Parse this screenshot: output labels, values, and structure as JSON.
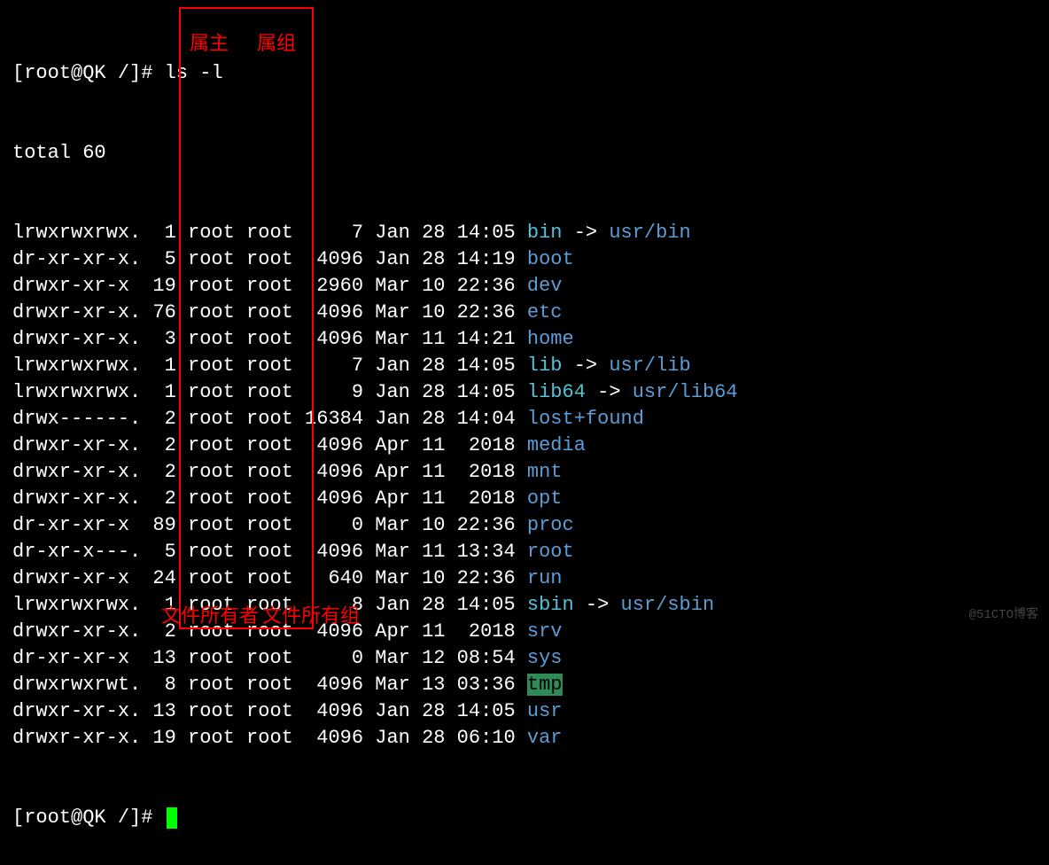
{
  "prompt1": "[root@QK /]# ",
  "command": "ls -l",
  "total_line": "total 60",
  "entries": [
    {
      "perm": "lrwxrwxrwx.",
      "links": "1",
      "owner": "root",
      "group": "root",
      "size": "7",
      "month": "Jan",
      "day": "28",
      "time": "14:05",
      "name": "bin",
      "type": "link",
      "target": "usr/bin"
    },
    {
      "perm": "dr-xr-xr-x.",
      "links": "5",
      "owner": "root",
      "group": "root",
      "size": "4096",
      "month": "Jan",
      "day": "28",
      "time": "14:19",
      "name": "boot",
      "type": "dir"
    },
    {
      "perm": "drwxr-xr-x",
      "links": "19",
      "owner": "root",
      "group": "root",
      "size": "2960",
      "month": "Mar",
      "day": "10",
      "time": "22:36",
      "name": "dev",
      "type": "dir"
    },
    {
      "perm": "drwxr-xr-x.",
      "links": "76",
      "owner": "root",
      "group": "root",
      "size": "4096",
      "month": "Mar",
      "day": "10",
      "time": "22:36",
      "name": "etc",
      "type": "dir"
    },
    {
      "perm": "drwxr-xr-x.",
      "links": "3",
      "owner": "root",
      "group": "root",
      "size": "4096",
      "month": "Mar",
      "day": "11",
      "time": "14:21",
      "name": "home",
      "type": "dir"
    },
    {
      "perm": "lrwxrwxrwx.",
      "links": "1",
      "owner": "root",
      "group": "root",
      "size": "7",
      "month": "Jan",
      "day": "28",
      "time": "14:05",
      "name": "lib",
      "type": "link",
      "target": "usr/lib"
    },
    {
      "perm": "lrwxrwxrwx.",
      "links": "1",
      "owner": "root",
      "group": "root",
      "size": "9",
      "month": "Jan",
      "day": "28",
      "time": "14:05",
      "name": "lib64",
      "type": "link",
      "target": "usr/lib64"
    },
    {
      "perm": "drwx------.",
      "links": "2",
      "owner": "root",
      "group": "root",
      "size": "16384",
      "month": "Jan",
      "day": "28",
      "time": "14:04",
      "name": "lost+found",
      "type": "dir"
    },
    {
      "perm": "drwxr-xr-x.",
      "links": "2",
      "owner": "root",
      "group": "root",
      "size": "4096",
      "month": "Apr",
      "day": "11",
      "time": "2018",
      "name": "media",
      "type": "dir"
    },
    {
      "perm": "drwxr-xr-x.",
      "links": "2",
      "owner": "root",
      "group": "root",
      "size": "4096",
      "month": "Apr",
      "day": "11",
      "time": "2018",
      "name": "mnt",
      "type": "dir"
    },
    {
      "perm": "drwxr-xr-x.",
      "links": "2",
      "owner": "root",
      "group": "root",
      "size": "4096",
      "month": "Apr",
      "day": "11",
      "time": "2018",
      "name": "opt",
      "type": "dir"
    },
    {
      "perm": "dr-xr-xr-x",
      "links": "89",
      "owner": "root",
      "group": "root",
      "size": "0",
      "month": "Mar",
      "day": "10",
      "time": "22:36",
      "name": "proc",
      "type": "dir"
    },
    {
      "perm": "dr-xr-x---.",
      "links": "5",
      "owner": "root",
      "group": "root",
      "size": "4096",
      "month": "Mar",
      "day": "11",
      "time": "13:34",
      "name": "root",
      "type": "dir"
    },
    {
      "perm": "drwxr-xr-x",
      "links": "24",
      "owner": "root",
      "group": "root",
      "size": "640",
      "month": "Mar",
      "day": "10",
      "time": "22:36",
      "name": "run",
      "type": "dir"
    },
    {
      "perm": "lrwxrwxrwx.",
      "links": "1",
      "owner": "root",
      "group": "root",
      "size": "8",
      "month": "Jan",
      "day": "28",
      "time": "14:05",
      "name": "sbin",
      "type": "link",
      "target": "usr/sbin"
    },
    {
      "perm": "drwxr-xr-x.",
      "links": "2",
      "owner": "root",
      "group": "root",
      "size": "4096",
      "month": "Apr",
      "day": "11",
      "time": "2018",
      "name": "srv",
      "type": "dir"
    },
    {
      "perm": "dr-xr-xr-x",
      "links": "13",
      "owner": "root",
      "group": "root",
      "size": "0",
      "month": "Mar",
      "day": "12",
      "time": "08:54",
      "name": "sys",
      "type": "dir"
    },
    {
      "perm": "drwxrwxrwt.",
      "links": "8",
      "owner": "root",
      "group": "root",
      "size": "4096",
      "month": "Mar",
      "day": "13",
      "time": "03:36",
      "name": "tmp",
      "type": "sticky"
    },
    {
      "perm": "drwxr-xr-x.",
      "links": "13",
      "owner": "root",
      "group": "root",
      "size": "4096",
      "month": "Jan",
      "day": "28",
      "time": "14:05",
      "name": "usr",
      "type": "dir"
    },
    {
      "perm": "drwxr-xr-x.",
      "links": "19",
      "owner": "root",
      "group": "root",
      "size": "4096",
      "month": "Jan",
      "day": "28",
      "time": "06:10",
      "name": "var",
      "type": "dir"
    }
  ],
  "prompt2": "[root@QK /]# ",
  "annotations": {
    "owner_top": "属主",
    "group_top": "属组",
    "owner_bottom": "文件所有者",
    "group_bottom": "文件所有组"
  },
  "watermark": "@51CTO博客"
}
